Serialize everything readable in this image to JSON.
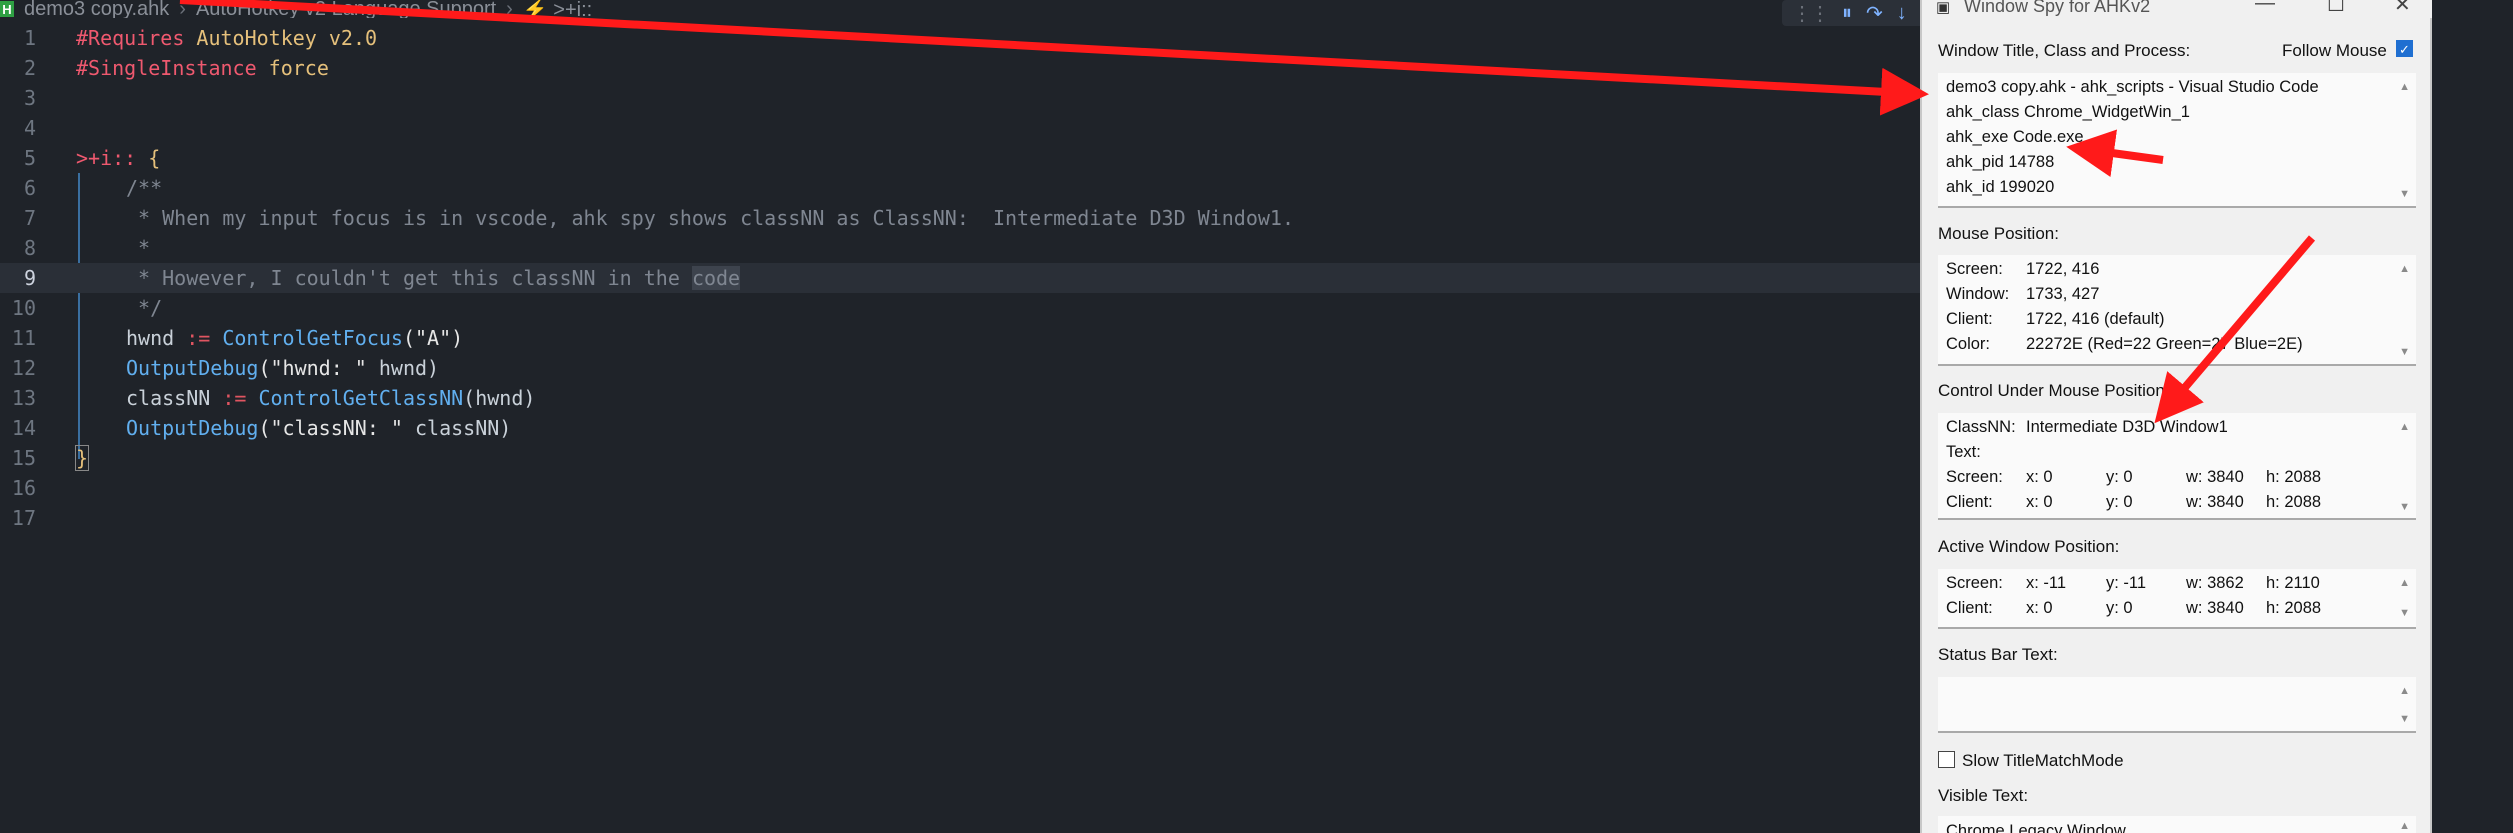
{
  "editor": {
    "breadcrumb": {
      "file": "demo3 copy.ahk",
      "crumbs": [
        "demo3 copy.ahk",
        "AutoHotkey v2 Language Support",
        "⚡ >+i::"
      ]
    },
    "lines": [
      {
        "n": "1"
      },
      {
        "n": "2"
      },
      {
        "n": "3"
      },
      {
        "n": "4"
      },
      {
        "n": "5"
      },
      {
        "n": "6"
      },
      {
        "n": "7"
      },
      {
        "n": "8"
      },
      {
        "n": "9"
      },
      {
        "n": "10"
      },
      {
        "n": "11"
      },
      {
        "n": "12"
      },
      {
        "n": "13"
      },
      {
        "n": "14"
      },
      {
        "n": "15"
      },
      {
        "n": "16"
      },
      {
        "n": "17"
      }
    ],
    "code": {
      "l1_dir": "#Requires",
      "l1_rest": " AutoHotkey v2.0",
      "l2_dir": "#SingleInstance",
      "l2_rest": " force",
      "l5_hotkey": ">+i::",
      "l5_brace": " {",
      "l6": "/**",
      "l7": " * When my input focus is in vscode, ahk spy shows classNN as ClassNN:  Intermediate D3D Window1.",
      "l8": " *",
      "l9_a": " * However, I couldn't get this classNN in the ",
      "l9_sel": "code",
      "l10": " */",
      "l11_var": "hwnd",
      "l11_op": " := ",
      "l11_fn": "ControlGetFocus",
      "l11_arg": "(\"A\")",
      "l12_fn": "OutputDebug",
      "l12_arg1": "(\"hwnd: \"",
      "l12_arg2": " hwnd)",
      "l13_var": "classNN",
      "l13_op": " := ",
      "l13_fn": "ControlGetClassNN",
      "l13_arg": "(hwnd)",
      "l14_fn": "OutputDebug",
      "l14_arg1": "(\"classNN: \"",
      "l14_arg2": " classNN)",
      "l15": "}"
    },
    "debug_toolbar": {
      "grip": "⋮⋮",
      "pause": "⏸",
      "step_over": "↷",
      "step_into": "↓"
    }
  },
  "spy": {
    "title": "Window Spy for AHKv2",
    "window_buttons": {
      "minimize": "—",
      "maximize": "☐",
      "close": "✕"
    },
    "win_section": {
      "label": "Window Title, Class and Process:",
      "follow_mouse_label": "Follow Mouse",
      "follow_mouse_checked": true,
      "lines": [
        "demo3 copy.ahk - ahk_scripts - Visual Studio Code",
        "ahk_class Chrome_WidgetWin_1",
        "ahk_exe Code.exe",
        "ahk_pid 14788",
        "ahk_id 199020"
      ]
    },
    "mouse_section": {
      "label": "Mouse Position:",
      "rows": [
        {
          "k": "Screen:",
          "v": "1722, 416"
        },
        {
          "k": "Window:",
          "v": "1733, 427"
        },
        {
          "k": "Client:",
          "v": "1722, 416 (default)"
        },
        {
          "k": "Color:",
          "v": "22272E (Red=22 Green=27 Blue=2E)"
        }
      ]
    },
    "control_section": {
      "label": "Control Under Mouse Position:",
      "classnn_key": "ClassNN:",
      "classnn_val": "Intermediate D3D Window1",
      "text_key": "Text:",
      "rows": [
        {
          "k": "Screen:",
          "x": "x: 0",
          "y": "y: 0",
          "w": "w: 3840",
          "h": "h: 2088"
        },
        {
          "k": "Client:",
          "x": "x: 0",
          "y": "y: 0",
          "w": "w: 3840",
          "h": "h: 2088"
        }
      ]
    },
    "active_section": {
      "label": "Active Window Position:",
      "rows": [
        {
          "k": "Screen:",
          "x": "x: -11",
          "y": "y: -11",
          "w": "w: 3862",
          "h": "h: 2110"
        },
        {
          "k": "Client:",
          "x": "x: 0",
          "y": "y: 0",
          "w": "w: 3840",
          "h": "h: 2088"
        }
      ]
    },
    "status_section": {
      "label": "Status Bar Text:",
      "value": ""
    },
    "slow_title": {
      "label": "Slow TitleMatchMode",
      "checked": false
    },
    "visible_text": {
      "label": "Visible Text:",
      "first_line": "Chrome Legacy Window"
    },
    "scroll": {
      "up": "▲",
      "down": "▼"
    }
  },
  "annotations": {
    "arrow_color": "#ff1a1a"
  }
}
